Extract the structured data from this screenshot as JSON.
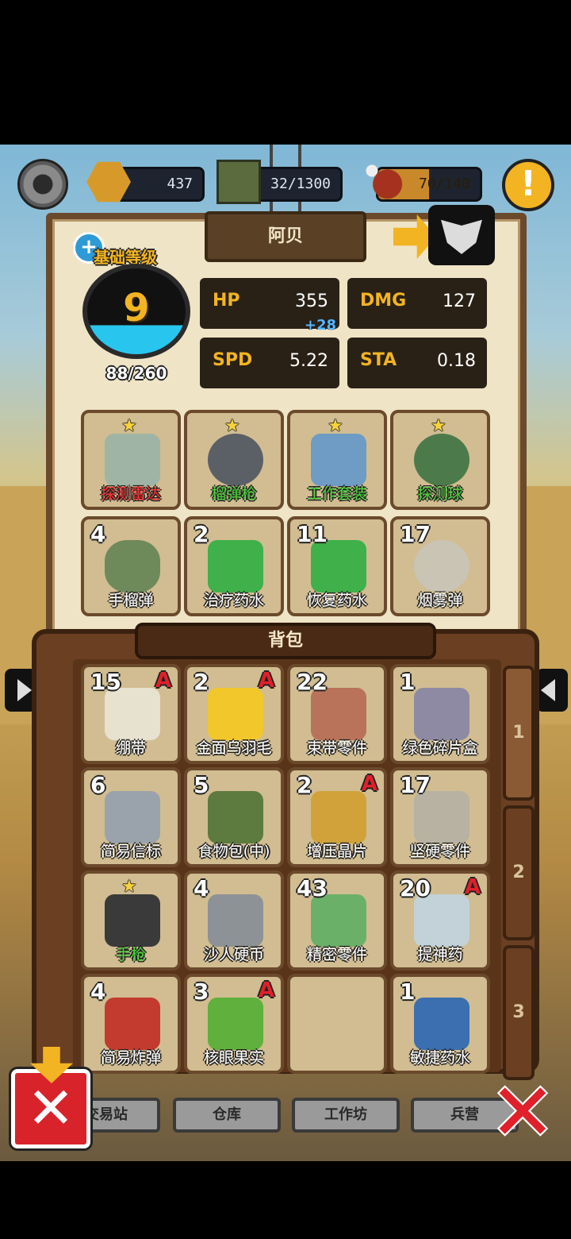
{
  "resources": {
    "hex": "437",
    "crates": "32/1300",
    "food": "70/140",
    "food_fill": 0.5
  },
  "character": {
    "name": "阿贝",
    "level_label": "基础等级",
    "level": "9",
    "xp": "88/260",
    "xp_fraction": 0.34,
    "stats": {
      "hp_label": "HP",
      "hp": "355",
      "hp_bonus": "+28",
      "dmg_label": "DMG",
      "dmg": "127",
      "spd_label": "SPD",
      "spd": "5.22",
      "sta_label": "STA",
      "sta": "0.18"
    },
    "equipment": [
      {
        "label": "探测雷达",
        "color": "red",
        "star": "★"
      },
      {
        "label": "榴弹枪",
        "color": "green",
        "star": "★"
      },
      {
        "label": "工作套装",
        "color": "green",
        "star": "★"
      },
      {
        "label": "探测球",
        "color": "green",
        "star": "★"
      }
    ],
    "quick_items": [
      {
        "qty": "4",
        "label": "手榴弹"
      },
      {
        "qty": "2",
        "label": "治疗药水"
      },
      {
        "qty": "11",
        "label": "恢复药水"
      },
      {
        "qty": "17",
        "label": "烟雾弹"
      }
    ]
  },
  "backpack": {
    "title": "背包",
    "pages": [
      "1",
      "2",
      "3"
    ],
    "items": [
      {
        "qty": "15",
        "rank": "A",
        "label": "绷带"
      },
      {
        "qty": "2",
        "rank": "A",
        "label": "金面乌羽毛"
      },
      {
        "qty": "22",
        "rank": "",
        "label": "束带零件"
      },
      {
        "qty": "1",
        "rank": "",
        "label": "绿色碎片盒"
      },
      {
        "qty": "6",
        "rank": "",
        "label": "简易信标"
      },
      {
        "qty": "5",
        "rank": "",
        "label": "食物包(中)"
      },
      {
        "qty": "2",
        "rank": "A",
        "label": "增压晶片"
      },
      {
        "qty": "17",
        "rank": "",
        "label": "坚硬零件"
      },
      {
        "qty": "",
        "rank": "",
        "label": "手枪",
        "star": "★"
      },
      {
        "qty": "4",
        "rank": "",
        "label": "沙人硬币"
      },
      {
        "qty": "43",
        "rank": "",
        "label": "精密零件"
      },
      {
        "qty": "20",
        "rank": "A",
        "label": "提神药"
      },
      {
        "qty": "4",
        "rank": "",
        "label": "简易炸弹"
      },
      {
        "qty": "3",
        "rank": "A",
        "label": "核眼果实"
      },
      {
        "qty": "",
        "rank": "",
        "label": ""
      },
      {
        "qty": "1",
        "rank": "",
        "label": "敏捷药水"
      }
    ]
  },
  "bottom_nav": [
    "交易站",
    "仓库",
    "工作坊",
    "兵营"
  ],
  "colors": {
    "accent": "#f2b422",
    "rank": "#e0202a",
    "panel": "#efe4c6",
    "wood": "#6b3f22"
  }
}
